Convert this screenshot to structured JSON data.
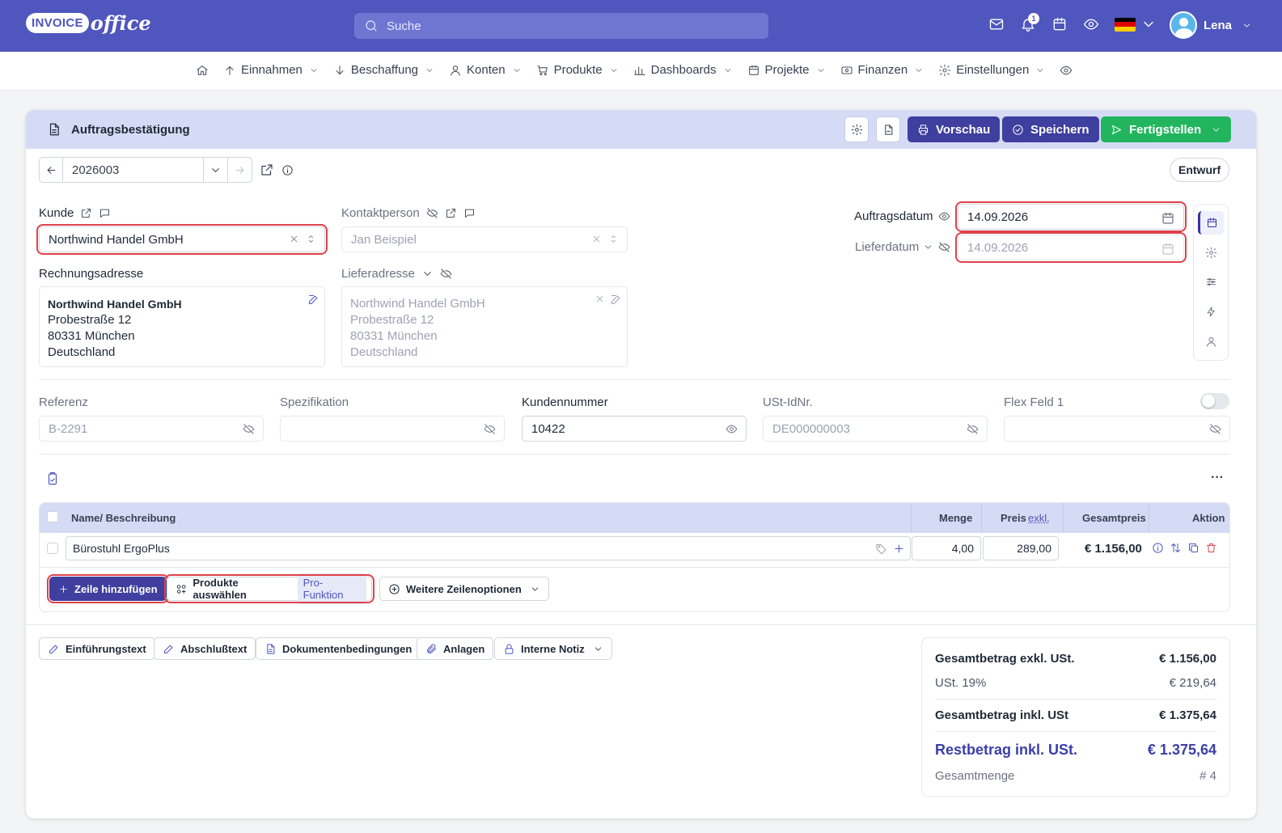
{
  "header": {
    "logo_badge": "INVOICE",
    "logo_text": "office",
    "search_placeholder": "Suche",
    "notification_count": "1",
    "user_name": "Lena",
    "flag_colors": [
      "#000000",
      "#dd0000",
      "#ffce00"
    ]
  },
  "nav": {
    "items": [
      {
        "label": "Einnahmen",
        "icon": "arrow-up-icon"
      },
      {
        "label": "Beschaffung",
        "icon": "arrow-down-icon"
      },
      {
        "label": "Konten",
        "icon": "user-icon"
      },
      {
        "label": "Produkte",
        "icon": "cart-icon"
      },
      {
        "label": "Dashboards",
        "icon": "bar-chart-icon"
      },
      {
        "label": "Projekte",
        "icon": "calendar-icon"
      },
      {
        "label": "Finanzen",
        "icon": "money-icon"
      },
      {
        "label": "Einstellungen",
        "icon": "gear-icon"
      }
    ]
  },
  "doc": {
    "title": "Auftragsbestätigung",
    "preview_label": "Vorschau",
    "save_label": "Speichern",
    "finish_label": "Fertigstellen",
    "number": "2026003",
    "status": "Entwurf"
  },
  "colors": {
    "primary": "#4f56bd",
    "button_dark": "#3f3f9f",
    "success": "#22b55e",
    "highlight": "#e0414b",
    "header_bg": "#d6dbf5"
  },
  "customer": {
    "label": "Kunde",
    "value": "Northwind Handel GmbH",
    "contact_label": "Kontaktperson",
    "contact_value": "Jan Beispiel"
  },
  "billing": {
    "label": "Rechnungsadresse",
    "lines": [
      "Northwind Handel GmbH",
      "Probestraße 12",
      "80331 München",
      "Deutschland"
    ]
  },
  "delivery": {
    "label": "Lieferadresse",
    "lines": [
      "Northwind Handel GmbH",
      "Probestraße 12",
      "80331 München",
      "Deutschland"
    ]
  },
  "dates": {
    "order_label": "Auftragsdatum",
    "order_value": "14.09.2026",
    "delivery_label": "Lieferdatum",
    "delivery_value": "14.09.2026"
  },
  "fields": [
    {
      "label": "Referenz",
      "value": "B-2291",
      "dim": true
    },
    {
      "label": "Spezifikation",
      "value": "",
      "dim": true
    },
    {
      "label": "Kundennummer",
      "value": "10422",
      "dim": false
    },
    {
      "label": "USt-IdNr.",
      "value": "DE000000003",
      "dim": true
    },
    {
      "label": "Flex Feld 1",
      "value": "",
      "dim": true
    }
  ],
  "table": {
    "headers": {
      "name": "Name/ Beschreibung",
      "qty": "Menge",
      "price": "Preis",
      "price_suffix": "exkl.",
      "total": "Gesamtpreis",
      "action": "Aktion"
    },
    "rows": [
      {
        "name": "Bürostuhl ErgoPlus",
        "qty": "4,00",
        "price": "289,00",
        "total": "€ 1.156,00"
      }
    ],
    "add_row_label": "Zeile hinzufügen",
    "select_products_label": "Produkte auswählen",
    "pro_label": "Pro-Funktion",
    "more_options_label": "Weitere Zeilenoptionen",
    "menu_label": "···"
  },
  "bottom_buttons": {
    "intro": "Einführungstext",
    "closing": "Abschlußtext",
    "conditions": "Dokumentenbedingungen",
    "attachments": "Anlagen",
    "internal_note": "Interne Notiz"
  },
  "totals": {
    "net_label": "Gesamtbetrag exkl. USt.",
    "net_value": "€ 1.156,00",
    "vat_label": "USt. 19%",
    "vat_value": "€ 219,64",
    "gross_label": "Gesamtbetrag inkl. USt",
    "gross_value": "€ 1.375,64",
    "remaining_label": "Restbetrag inkl. USt.",
    "remaining_value": "€ 1.375,64",
    "qty_label": "Gesamtmenge",
    "qty_value": "# 4"
  }
}
